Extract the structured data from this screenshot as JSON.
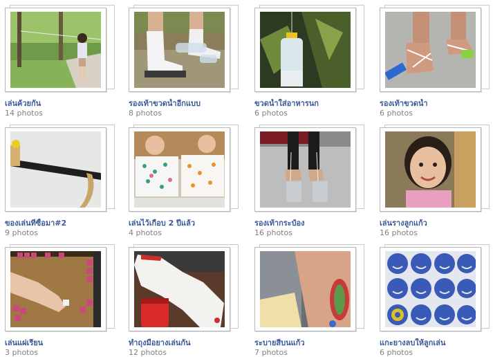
{
  "albums": [
    {
      "title": "เล่นค้วยกัน",
      "count": "14 photos",
      "thumb_icon": "girl-with-rope-photo"
    },
    {
      "title": "รองเท้าขวดน้ำอีกแบบ",
      "count": "8 photos",
      "thumb_icon": "bottle-shoes-socks-photo"
    },
    {
      "title": "ขวดน้ำใส่อาหารนก",
      "count": "6 photos",
      "thumb_icon": "bird-feeder-bottle-photo"
    },
    {
      "title": "รองเท้าขวดน้ำ",
      "count": "6 photos",
      "thumb_icon": "bottle-sandals-photo"
    },
    {
      "title": "ของเล่นที่ซื้อมา#2",
      "count": "9 photos",
      "thumb_icon": "slingshot-toy-photo"
    },
    {
      "title": "เล่นไว้เกือบ 2 ปีแล้ว",
      "count": "4 photos",
      "thumb_icon": "kids-paintings-photo"
    },
    {
      "title": "รองเท้ากระป๋อง",
      "count": "16 photos",
      "thumb_icon": "can-stilts-photo"
    },
    {
      "title": "เล่นรางลูกแก้ว",
      "count": "16 photos",
      "thumb_icon": "smiling-girl-photo"
    },
    {
      "title": "เล่นแผ่เรียน",
      "count": "3 photos",
      "thumb_icon": "dice-game-photo"
    },
    {
      "title": "ทำถุงมือยางเล่นกัน",
      "count": "12 photos",
      "thumb_icon": "rubber-glove-photo"
    },
    {
      "title": "ระบายสีบนแก้ว",
      "count": "7 photos",
      "thumb_icon": "painted-arm-photo"
    },
    {
      "title": "แกะยางลบให้ลูกเล่น",
      "count": "6 photos",
      "thumb_icon": "eraser-stamps-photo"
    }
  ]
}
